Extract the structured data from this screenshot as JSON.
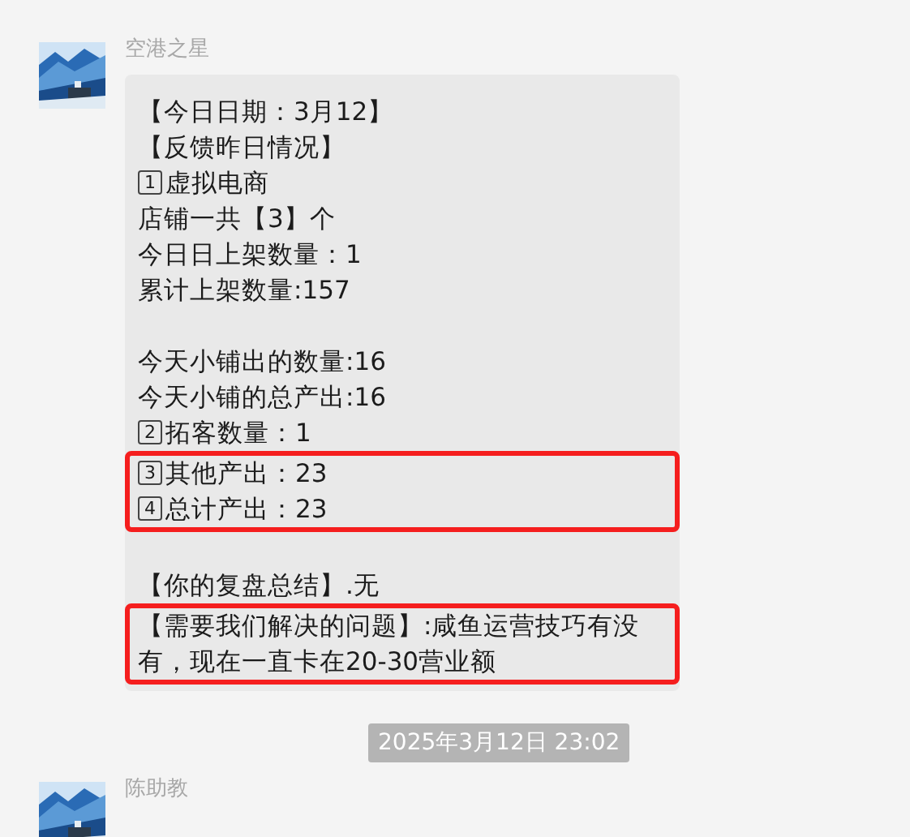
{
  "messages": [
    {
      "sender": "空港之星",
      "paragraphs": [
        {
          "groups": [
            {
              "highlighted": false,
              "lines": [
                {
                  "text": "【今日日期：3月12】"
                },
                {
                  "text": "【反馈昨日情况】"
                },
                {
                  "number": "1",
                  "text": "虚拟电商"
                },
                {
                  "text": "店铺一共【3】个"
                },
                {
                  "text": "今日日上架数量：1"
                },
                {
                  "text": "累计上架数量:157"
                }
              ]
            }
          ]
        },
        {
          "groups": [
            {
              "highlighted": false,
              "lines": [
                {
                  "text": "今天小铺出的数量:16"
                },
                {
                  "text": "今天小铺的总产出:16"
                },
                {
                  "number": "2",
                  "text": "拓客数量：1"
                }
              ]
            },
            {
              "highlighted": true,
              "lines": [
                {
                  "number": "3",
                  "text": "其他产出：23"
                },
                {
                  "number": "4",
                  "text": "总计产出：23"
                }
              ]
            }
          ]
        },
        {
          "groups": [
            {
              "highlighted": false,
              "lines": [
                {
                  "text": "【你的复盘总结】.无"
                }
              ]
            },
            {
              "highlighted": true,
              "lines": [
                {
                  "text": "【需要我们解决的问题】:咸鱼运营技巧有没有，现在一直卡在20-30营业额"
                }
              ]
            }
          ]
        }
      ]
    },
    {
      "kind": "timestamp",
      "text": "2025年3月12日 23:02"
    },
    {
      "sender": "陈助教"
    }
  ]
}
